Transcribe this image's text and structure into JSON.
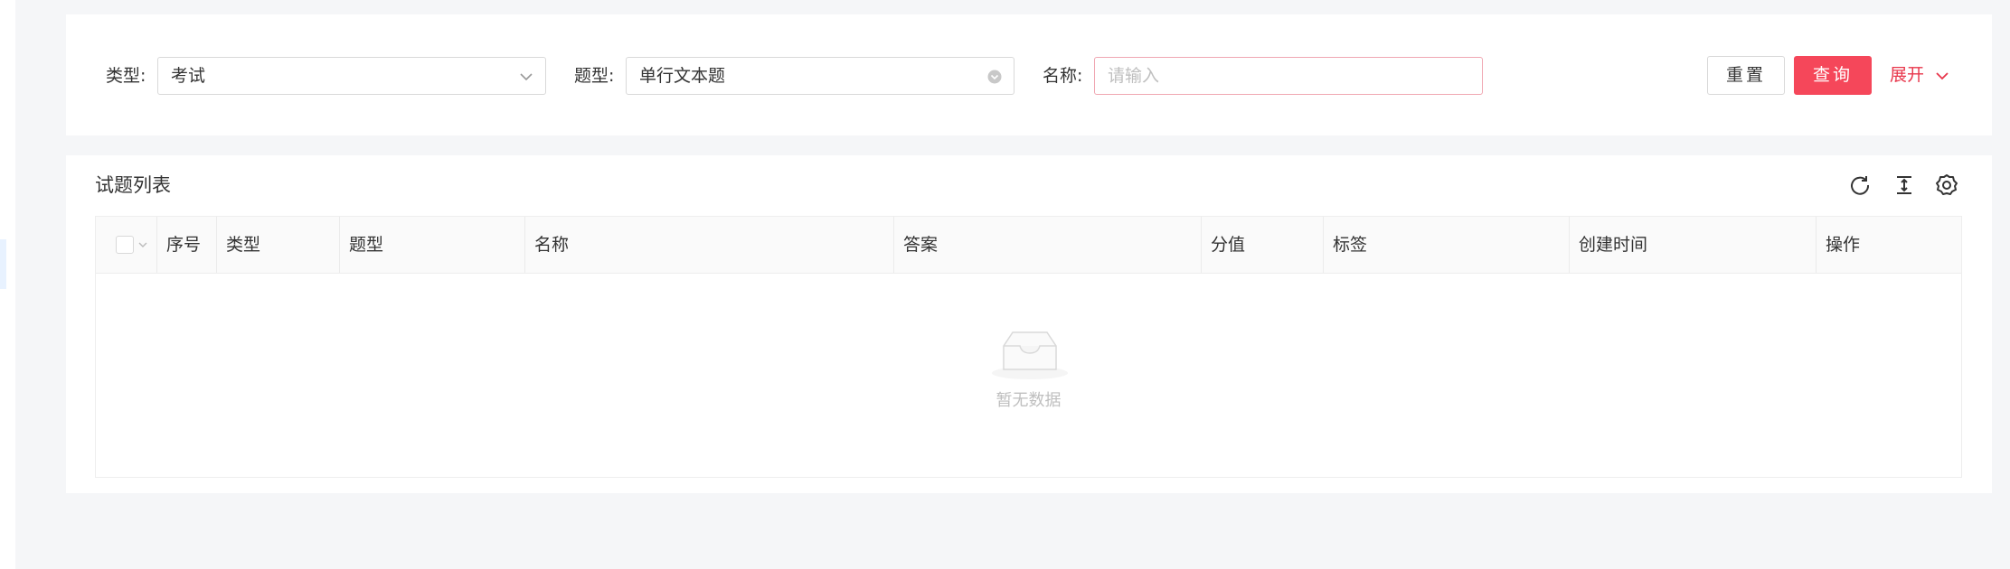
{
  "search": {
    "type_label": "类型:",
    "type_value": "考试",
    "qtype_label": "题型:",
    "qtype_value": "单行文本题",
    "name_label": "名称:",
    "name_placeholder": "请输入",
    "reset_label": "重置",
    "query_label": "查询",
    "expand_label": "展开"
  },
  "list": {
    "title": "试题列表",
    "columns": [
      "序号",
      "类型",
      "题型",
      "名称",
      "答案",
      "分值",
      "标签",
      "创建时间",
      "操作"
    ],
    "empty_text": "暂无数据"
  },
  "colors": {
    "primary": "#f5475a",
    "link": "#e8364b"
  }
}
